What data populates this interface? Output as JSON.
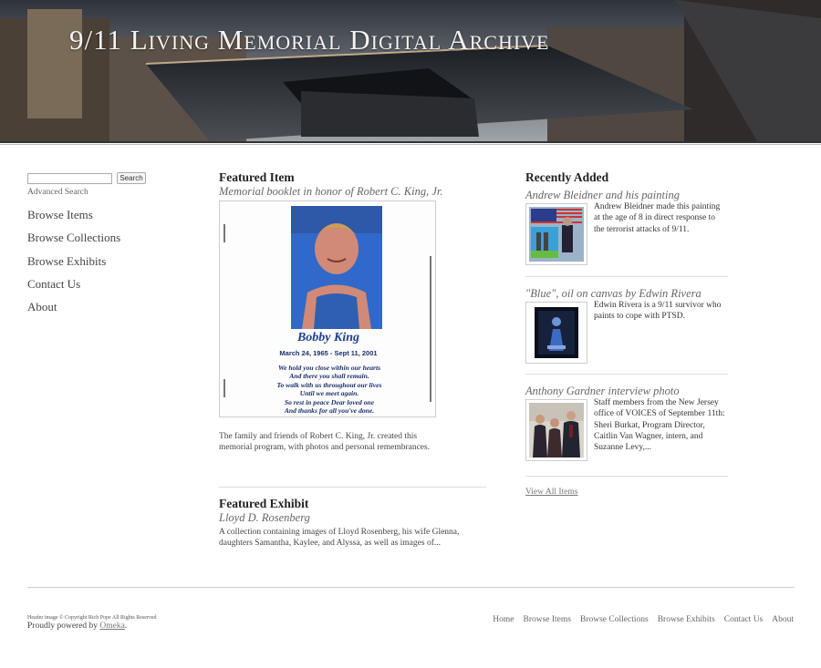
{
  "header": {
    "site_title": "9/11 Living Memorial Digital Archive"
  },
  "search": {
    "placeholder": "",
    "button_label": "Search",
    "advanced_label": "Advanced Search"
  },
  "nav": {
    "items": [
      {
        "label": "Browse Items"
      },
      {
        "label": "Browse Collections"
      },
      {
        "label": "Browse Exhibits"
      },
      {
        "label": "Contact Us"
      },
      {
        "label": "About"
      }
    ]
  },
  "featured_item": {
    "heading": "Featured Item",
    "title": "Memorial booklet in honor of Robert C. King, Jr.",
    "image": {
      "name": "Bobby King",
      "dates": "March 24, 1965  -  Sept 11, 2001",
      "poem": [
        "We hold you close within our hearts",
        "And there you shall remain.",
        "To walk with us throughout our lives",
        "Until we meet again.",
        "So rest in peace Dear loved one",
        "And thanks for all you've done."
      ]
    },
    "description": "The family and friends of Robert C. King, Jr. created this memorial program, with photos and personal remembrances."
  },
  "featured_exhibit": {
    "heading": "Featured Exhibit",
    "title": "Lloyd D. Rosenberg",
    "description": "A collection containing images of Lloyd Rosenberg, his wife Glenna, daughters Samantha, Kaylee, and Alyssa, as well as images of..."
  },
  "recently_added": {
    "heading": "Recently Added",
    "items": [
      {
        "title": "Andrew Bleidner and his painting",
        "description": "Andrew Bleidner made this painting at the age of 8 in direct response to the terrorist attacks of 9/11."
      },
      {
        "title": "\"Blue\", oil on canvas by Edwin Rivera",
        "description": "Edwin Rivera is a 9/11 survivor who paints to cope with PTSD."
      },
      {
        "title": "Anthony Gardner interview photo",
        "description": "Staff members from the New Jersey office of VOICES of September 11th: Sheri Burkat, Program Director, Caitlin Van Wagner, intern, and Suzanne Levy,..."
      }
    ],
    "view_all_label": "View All Items"
  },
  "footer": {
    "credit": "Header image © Copyright Rich Pope All Rights Reserved",
    "powered_prefix": "Proudly powered by ",
    "powered_link": "Omeka",
    "powered_suffix": ".",
    "nav": [
      {
        "label": "Home"
      },
      {
        "label": "Browse Items"
      },
      {
        "label": "Browse Collections"
      },
      {
        "label": "Browse Exhibits"
      },
      {
        "label": "Contact Us"
      },
      {
        "label": "About"
      }
    ]
  }
}
